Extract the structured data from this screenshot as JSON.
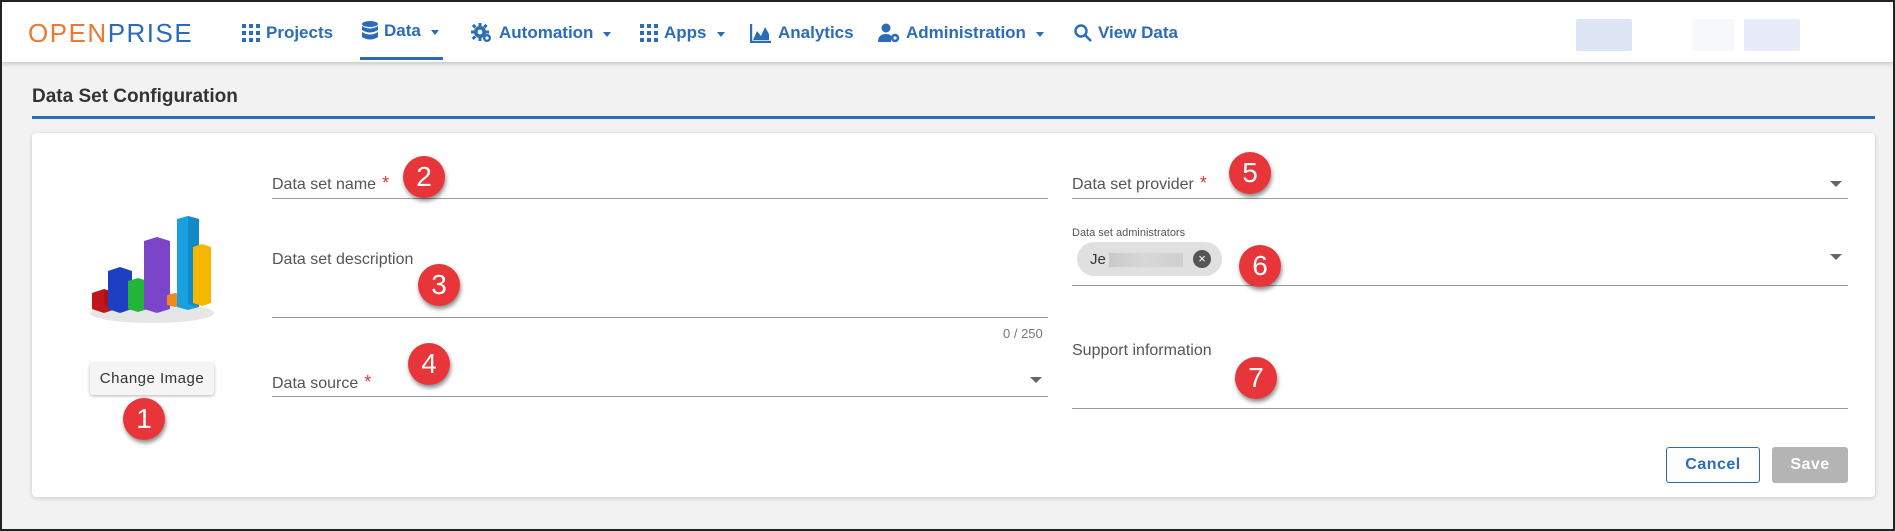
{
  "brand": {
    "logo_part1": "OPEN",
    "logo_part2": "PRISE",
    "accent": "#2b6cb8",
    "logo_orange": "#f0782d"
  },
  "nav": {
    "projects": "Projects",
    "data": "Data",
    "automation": "Automation",
    "apps": "Apps",
    "analytics": "Analytics",
    "administration": "Administration",
    "view_data": "View Data",
    "active": "Data"
  },
  "icons": {
    "projects": "grid-icon",
    "data": "database-icon",
    "automation": "gear-icon",
    "apps": "grid-icon",
    "analytics": "chart-icon",
    "administration": "user-gear-icon",
    "view_data": "search-icon"
  },
  "page": {
    "title": "Data Set Configuration"
  },
  "form": {
    "name_label": "Data set name",
    "description_label": "Data set description",
    "description_counter": "0 / 250",
    "source_label": "Data source",
    "provider_label": "Data set provider",
    "administrators_label": "Data set administrators",
    "administrator_chip": "Je",
    "support_label": "Support information",
    "required_mark": "*"
  },
  "buttons": {
    "change_image": "Change Image",
    "cancel": "Cancel",
    "save": "Save"
  },
  "markers": [
    "1",
    "2",
    "3",
    "4",
    "5",
    "6",
    "7"
  ]
}
